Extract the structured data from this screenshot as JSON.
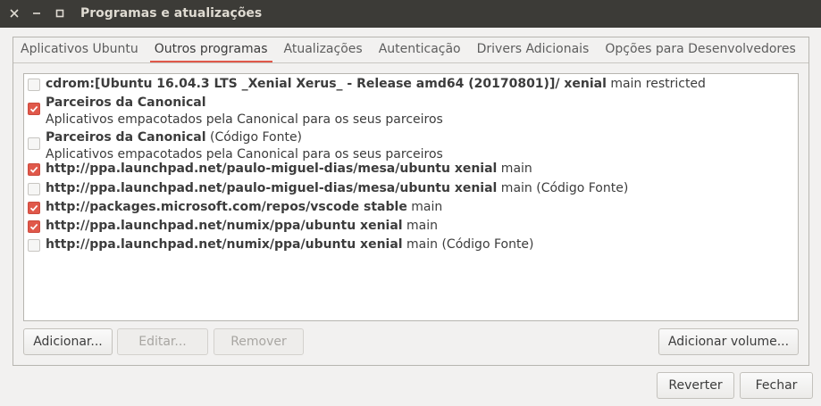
{
  "window": {
    "title": "Programas e atualizações"
  },
  "tabs": [
    {
      "label": "Aplicativos Ubuntu"
    },
    {
      "label": "Outros programas"
    },
    {
      "label": "Atualizações"
    },
    {
      "label": "Autenticação"
    },
    {
      "label": "Drivers Adicionais"
    },
    {
      "label": "Opções para Desenvolvedores"
    }
  ],
  "active_tab": "Outros programas",
  "sources": [
    {
      "checked": false,
      "bold": "cdrom:[Ubuntu 16.04.3 LTS _Xenial Xerus_ - Release amd64 (20170801)]/ xenial",
      "rest": " main restricted",
      "sub": ""
    },
    {
      "checked": true,
      "bold": "Parceiros da Canonical",
      "rest": "",
      "sub": "Aplicativos empacotados pela Canonical para os seus parceiros"
    },
    {
      "checked": false,
      "bold": "Parceiros da Canonical",
      "rest": " (Código Fonte)",
      "sub": "Aplicativos empacotados pela Canonical para os seus parceiros"
    },
    {
      "checked": true,
      "bold": "http://ppa.launchpad.net/paulo-miguel-dias/mesa/ubuntu xenial",
      "rest": " main",
      "sub": ""
    },
    {
      "checked": false,
      "bold": "http://ppa.launchpad.net/paulo-miguel-dias/mesa/ubuntu xenial",
      "rest": " main (Código Fonte)",
      "sub": ""
    },
    {
      "checked": true,
      "bold": "http://packages.microsoft.com/repos/vscode stable",
      "rest": " main",
      "sub": ""
    },
    {
      "checked": true,
      "bold": "http://ppa.launchpad.net/numix/ppa/ubuntu xenial",
      "rest": " main",
      "sub": ""
    },
    {
      "checked": false,
      "bold": "http://ppa.launchpad.net/numix/ppa/ubuntu xenial",
      "rest": " main (Código Fonte)",
      "sub": ""
    }
  ],
  "list_buttons": {
    "add": "Adicionar...",
    "edit": "Editar...",
    "remove": "Remover",
    "add_volume": "Adicionar volume..."
  },
  "dialog_buttons": {
    "revert": "Reverter",
    "close": "Fechar"
  },
  "colors": {
    "accent": "#e0584a",
    "titlebar": "#3c3b37"
  }
}
